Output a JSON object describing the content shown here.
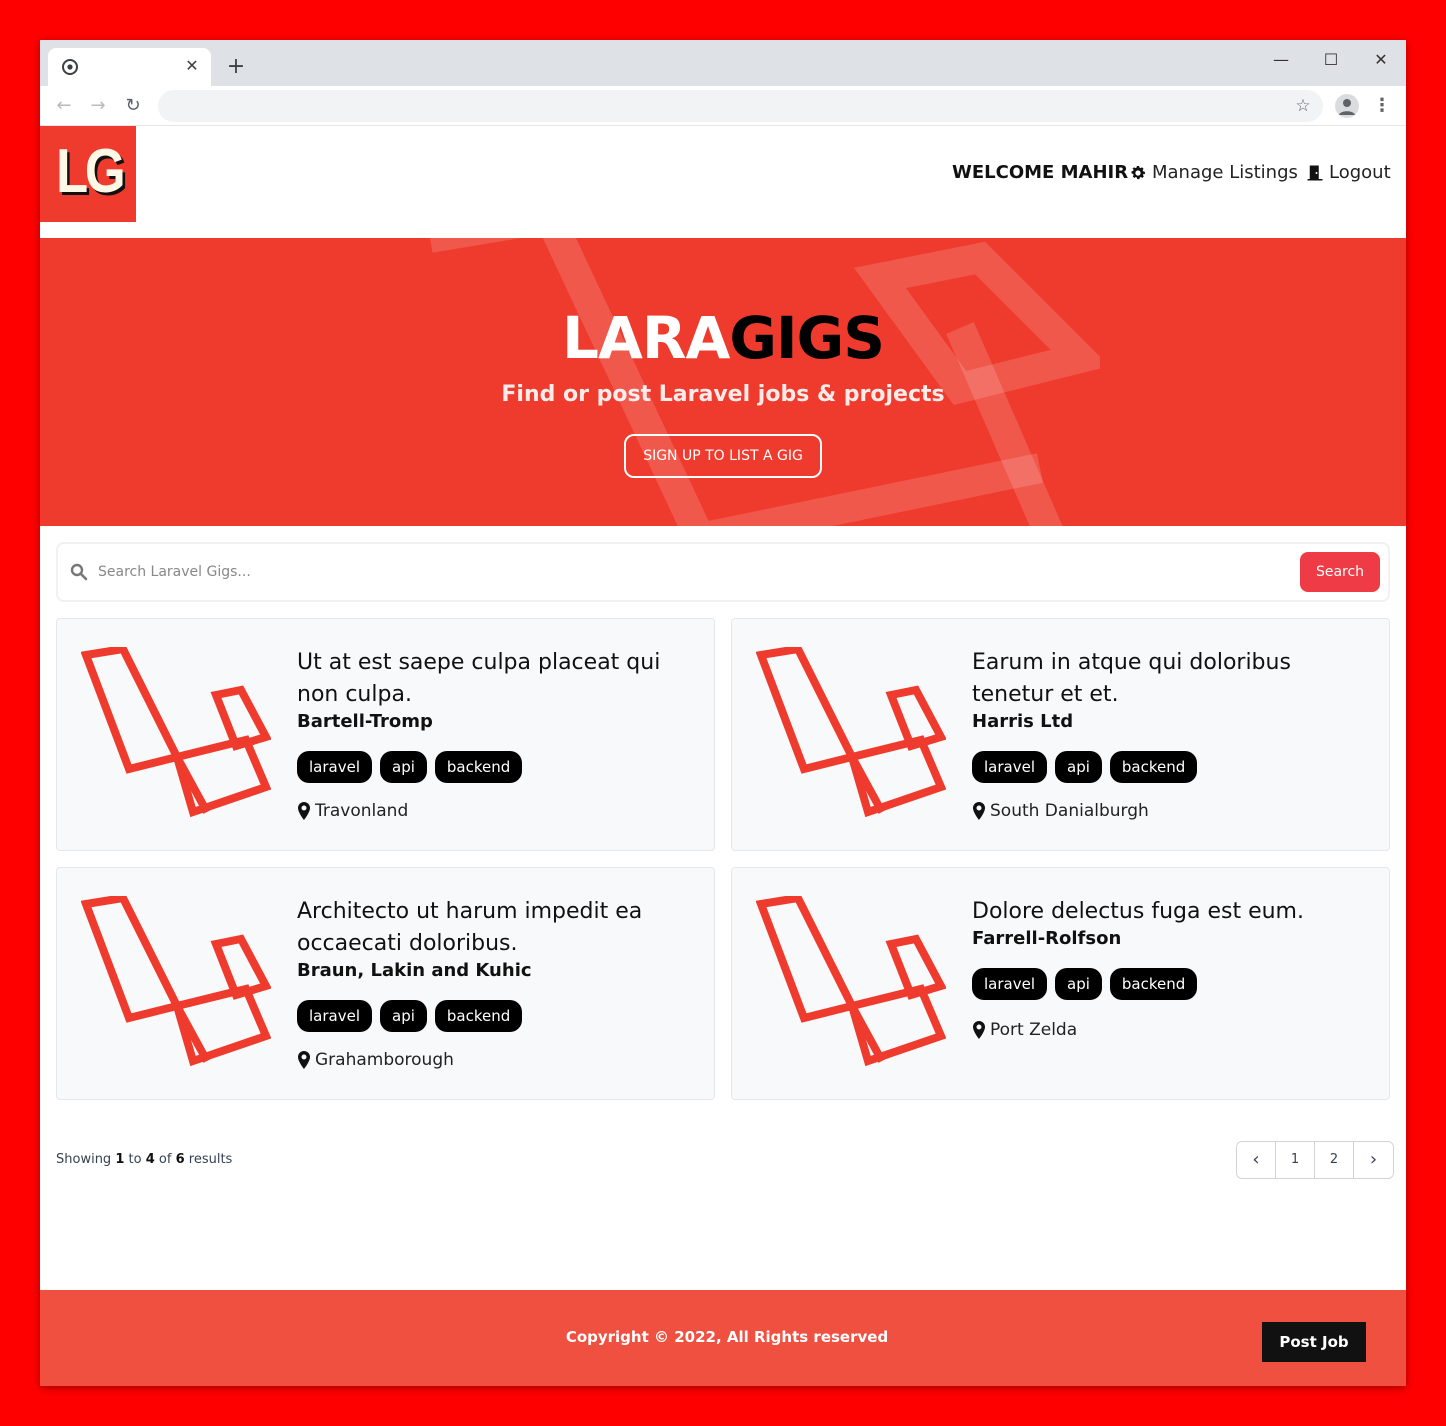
{
  "browser": {
    "tab_close": "✕",
    "new_tab": "+",
    "minimize": "—",
    "maximize": "☐",
    "close": "✕",
    "back": "←",
    "forward": "→",
    "reload": "↻",
    "star": "☆",
    "menu": "⋮",
    "icons": [
      "chrome-icon",
      "back-arrow-icon",
      "forward-arrow-icon",
      "reload-icon",
      "star-icon",
      "profile-icon",
      "kebab-menu-icon"
    ]
  },
  "brand": {
    "logo": "LG",
    "accent": "#ef3b2d"
  },
  "nav": {
    "welcome": "WELCOME MAHIR",
    "manage": "Manage Listings",
    "logout": "Logout"
  },
  "hero": {
    "title_a": "LARA",
    "title_b": "GIGS",
    "subtitle": "Find or post Laravel jobs & projects",
    "button": "SIGN UP TO LIST A GIG"
  },
  "search": {
    "placeholder": "Search Laravel Gigs...",
    "button": "Search"
  },
  "listings": [
    {
      "title": "Ut at est saepe culpa placeat qui non culpa.",
      "company": "Bartell-Tromp",
      "tags": [
        "laravel",
        "api",
        "backend"
      ],
      "location": "Travonland"
    },
    {
      "title": "Earum in atque qui doloribus tenetur et et.",
      "company": "Harris Ltd",
      "tags": [
        "laravel",
        "api",
        "backend"
      ],
      "location": "South Danialburgh"
    },
    {
      "title": "Architecto ut harum impedit ea occaecati doloribus.",
      "company": "Braun, Lakin and Kuhic",
      "tags": [
        "laravel",
        "api",
        "backend"
      ],
      "location": "Grahamborough"
    },
    {
      "title": "Dolore delectus fuga est eum.",
      "company": "Farrell-Rolfson",
      "tags": [
        "laravel",
        "api",
        "backend"
      ],
      "location": "Port Zelda"
    }
  ],
  "pagination": {
    "showing": "Showing",
    "from": "1",
    "to_word": "to",
    "to": "4",
    "of_word": "of",
    "total": "6",
    "results": "results",
    "prev": "‹",
    "pages": [
      "1",
      "2"
    ],
    "next": "›"
  },
  "footer": {
    "copyright": "Copyright © 2022, All Rights reserved",
    "post_job": "Post Job"
  }
}
